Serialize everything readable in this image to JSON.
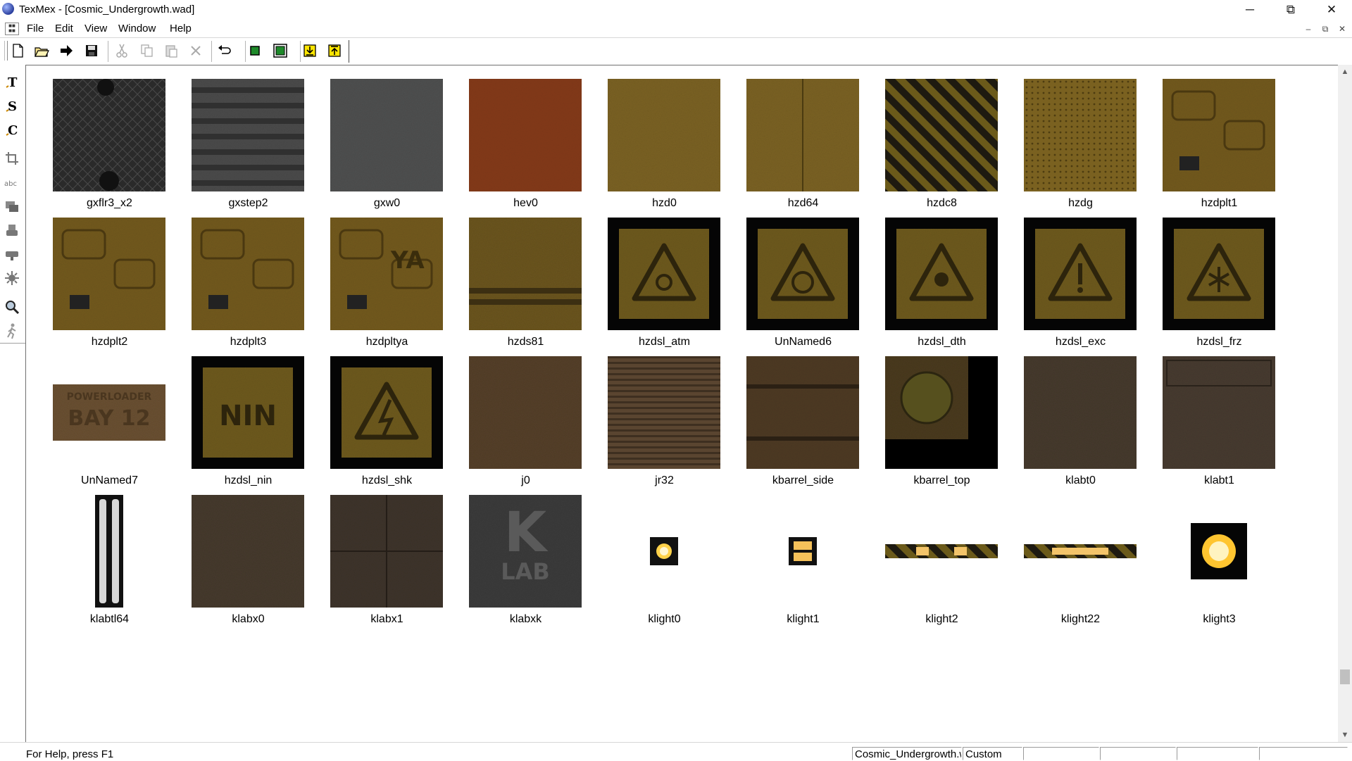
{
  "window": {
    "title": "TexMex - [Cosmic_Undergrowth.wad]",
    "controls": [
      "minimize-icon",
      "restore-icon",
      "close-icon"
    ]
  },
  "menu": {
    "items": [
      "File",
      "Edit",
      "View",
      "Window",
      "Help"
    ],
    "mdi_controls": [
      "mdi-minimize-icon",
      "mdi-restore-icon",
      "mdi-close-icon"
    ]
  },
  "toolbar": {
    "buttons": [
      {
        "name": "new-file-icon",
        "enabled": true
      },
      {
        "name": "open-folder-icon",
        "enabled": true
      },
      {
        "name": "forward-arrow-icon",
        "enabled": true
      },
      {
        "name": "save-disk-icon",
        "enabled": true
      },
      {
        "name": "cut-icon",
        "enabled": false
      },
      {
        "name": "copy-icon",
        "enabled": false
      },
      {
        "name": "paste-icon",
        "enabled": false
      },
      {
        "name": "delete-icon",
        "enabled": false
      },
      {
        "name": "undo-icon",
        "enabled": true
      },
      {
        "name": "small-square-icon",
        "enabled": true
      },
      {
        "name": "fit-square-icon",
        "enabled": true
      },
      {
        "name": "import-icon",
        "enabled": true
      },
      {
        "name": "export-icon",
        "enabled": true
      }
    ]
  },
  "left_tools": [
    "text-tool-icon",
    "s-tool-icon",
    "c-tool-icon",
    "crop-icon",
    "abc-tool-icon",
    "layers-icon",
    "stamp-icon",
    "roller-icon",
    "sun-icon",
    "zoom-icon",
    "walk-icon"
  ],
  "textures": [
    {
      "name": "gxflr3_x2",
      "style": "dark-mesh",
      "size": "full"
    },
    {
      "name": "gxstep2",
      "style": "grey-stripes",
      "size": "full"
    },
    {
      "name": "gxw0",
      "style": "grey-plain",
      "size": "full"
    },
    {
      "name": "hev0",
      "style": "rust-red",
      "size": "full"
    },
    {
      "name": "hzd0",
      "style": "yellow",
      "size": "full"
    },
    {
      "name": "hzd64",
      "style": "yellow-seam",
      "size": "full"
    },
    {
      "name": "hzdc8",
      "style": "hazard-stripes",
      "size": "full"
    },
    {
      "name": "hzdg",
      "style": "yellow-grate",
      "size": "full"
    },
    {
      "name": "hzdplt1",
      "style": "yellow-plate",
      "size": "full"
    },
    {
      "name": "hzdplt2",
      "style": "yellow-plate",
      "size": "full"
    },
    {
      "name": "hzdplt3",
      "style": "yellow-plate",
      "size": "full"
    },
    {
      "name": "hzdpltya",
      "style": "yellow-plate",
      "size": "full"
    },
    {
      "name": "hzds81",
      "style": "yellow-band",
      "size": "full"
    },
    {
      "name": "hzdsl_atm",
      "style": "hazard-sign",
      "size": "full"
    },
    {
      "name": "UnNamed6",
      "style": "hazard-sign",
      "size": "full"
    },
    {
      "name": "hzdsl_dth",
      "style": "hazard-sign",
      "size": "full"
    },
    {
      "name": "hzdsl_exc",
      "style": "hazard-sign",
      "size": "full"
    },
    {
      "name": "hzdsl_frz",
      "style": "hazard-sign",
      "size": "full"
    },
    {
      "name": "UnNamed7",
      "style": "powerloader-sign",
      "size": "wide"
    },
    {
      "name": "hzdsl_nin",
      "style": "hazard-sign",
      "size": "full"
    },
    {
      "name": "hzdsl_shk",
      "style": "hazard-sign",
      "size": "full"
    },
    {
      "name": "j0",
      "style": "brown-plain",
      "size": "full"
    },
    {
      "name": "jr32",
      "style": "brown-ribbed",
      "size": "full"
    },
    {
      "name": "kbarrel_side",
      "style": "brown-barrel",
      "size": "full"
    },
    {
      "name": "kbarrel_top",
      "style": "barrel-top",
      "size": "full"
    },
    {
      "name": "klabt0",
      "style": "dark-brown",
      "size": "full"
    },
    {
      "name": "klabt1",
      "style": "dark-brown-panel",
      "size": "full"
    },
    {
      "name": "klabtl64",
      "style": "light-tube",
      "size": "tall"
    },
    {
      "name": "klabx0",
      "style": "dark-brown",
      "size": "full"
    },
    {
      "name": "klabx1",
      "style": "dark-brown-quad",
      "size": "full"
    },
    {
      "name": "klabxk",
      "style": "klab-logo",
      "size": "full"
    },
    {
      "name": "klight0",
      "style": "light-small",
      "size": "tiny"
    },
    {
      "name": "klight1",
      "style": "light-double",
      "size": "tiny"
    },
    {
      "name": "klight2",
      "style": "light-strip",
      "size": "strip"
    },
    {
      "name": "klight22",
      "style": "light-strip2",
      "size": "strip"
    },
    {
      "name": "klight3",
      "style": "light-big",
      "size": "medium"
    }
  ],
  "klabxk_logo": {
    "big": "K",
    "small": "LAB"
  },
  "unnamed7_sign": {
    "line1": "POWERLOADER",
    "line2": "BAY 12"
  },
  "hzdpltya_mark": "YA",
  "hzdsl_nin_mark": "NIN",
  "status": {
    "help": "For Help, press F1",
    "file": "Cosmic_Undergrowth.wad",
    "mode": "Custom"
  }
}
